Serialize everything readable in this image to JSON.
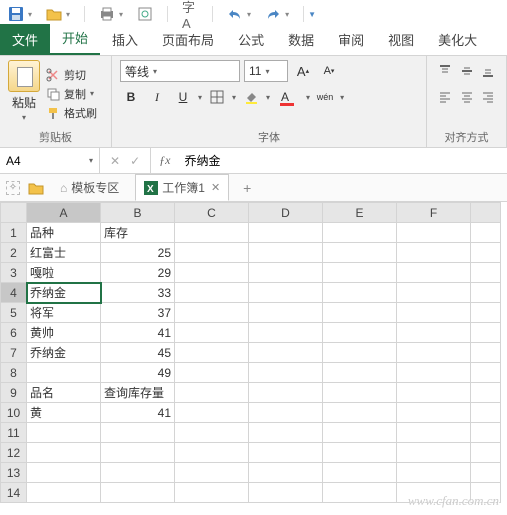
{
  "qat": {
    "save": "save-icon",
    "open": "open-icon",
    "undo": "undo-icon",
    "redo": "redo-icon"
  },
  "tabs": {
    "file": "文件",
    "home": "开始",
    "insert": "插入",
    "layout": "页面布局",
    "formulas": "公式",
    "data": "数据",
    "review": "审阅",
    "view": "视图",
    "beautify": "美化大"
  },
  "clipboard": {
    "paste": "粘贴",
    "cut": "剪切",
    "copy": "复制",
    "format": "格式刷",
    "group": "剪贴板"
  },
  "font": {
    "name": "等线",
    "size": "11",
    "bold": "B",
    "italic": "I",
    "underline": "U",
    "group": "字体",
    "ruby": "wén"
  },
  "align": {
    "group": "对齐方式"
  },
  "namebox": "A4",
  "formula": "乔纳金",
  "sheets": {
    "template": "模板专区",
    "workbook": "工作簿1"
  },
  "columns": [
    "A",
    "B",
    "C",
    "D",
    "E",
    "F"
  ],
  "rows": [
    {
      "n": 1,
      "A": "品种",
      "B": "库存"
    },
    {
      "n": 2,
      "A": "红富士",
      "B": "25"
    },
    {
      "n": 3,
      "A": "嘎啦",
      "B": "29"
    },
    {
      "n": 4,
      "A": "乔纳金",
      "B": "33"
    },
    {
      "n": 5,
      "A": "将军",
      "B": "37"
    },
    {
      "n": 6,
      "A": "黄帅",
      "B": "41"
    },
    {
      "n": 7,
      "A": "乔纳金",
      "B": "45"
    },
    {
      "n": 8,
      "A": "",
      "B": "49"
    },
    {
      "n": 9,
      "A": "品名",
      "B": "查询库存量"
    },
    {
      "n": 10,
      "A": "黄",
      "B": "41"
    },
    {
      "n": 11,
      "A": "",
      "B": ""
    },
    {
      "n": 12,
      "A": "",
      "B": ""
    },
    {
      "n": 13,
      "A": "",
      "B": ""
    },
    {
      "n": 14,
      "A": "",
      "B": ""
    }
  ],
  "active": {
    "row": 4,
    "col": "A"
  },
  "text_cells": {
    "1": [
      "B"
    ],
    "9": [
      "B"
    ]
  },
  "watermark": "www.cfan.com.cn"
}
